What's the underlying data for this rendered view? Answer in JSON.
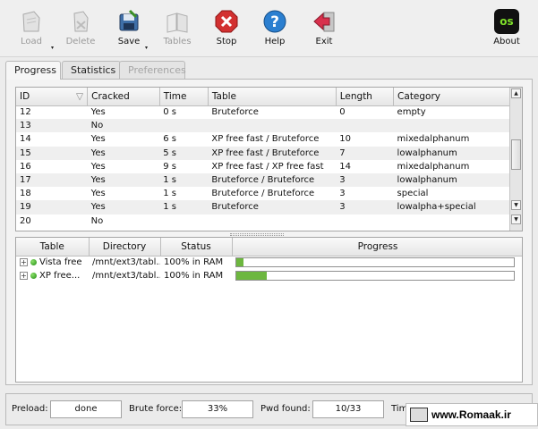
{
  "toolbar": {
    "load": "Load",
    "delete": "Delete",
    "save": "Save",
    "tables": "Tables",
    "stop": "Stop",
    "help": "Help",
    "exit": "Exit",
    "about": "About",
    "about_logo_text": "os"
  },
  "tabs": {
    "progress": "Progress",
    "statistics": "Statistics",
    "preferences": "Preferences"
  },
  "top_table": {
    "headers": [
      "ID",
      "Cracked",
      "Time",
      "Table",
      "Length",
      "Category"
    ],
    "rows": [
      [
        "12",
        "Yes",
        "0 s",
        "Bruteforce",
        "0",
        "empty"
      ],
      [
        "13",
        "No",
        "",
        "",
        "",
        ""
      ],
      [
        "14",
        "Yes",
        "6 s",
        "XP free fast / Bruteforce",
        "10",
        "mixedalphanum"
      ],
      [
        "15",
        "Yes",
        "5 s",
        "XP free fast / Bruteforce",
        "7",
        "lowalphanum"
      ],
      [
        "16",
        "Yes",
        "9 s",
        "XP free fast / XP free fast",
        "14",
        "mixedalphanum"
      ],
      [
        "17",
        "Yes",
        "1 s",
        "Bruteforce / Bruteforce",
        "3",
        "lowalphanum"
      ],
      [
        "18",
        "Yes",
        "1 s",
        "Bruteforce / Bruteforce",
        "3",
        "special"
      ],
      [
        "19",
        "Yes",
        "1 s",
        "Bruteforce",
        "3",
        "lowalpha+special"
      ],
      [
        "20",
        "No",
        "",
        "",
        "",
        ""
      ]
    ]
  },
  "bottom_table": {
    "headers": [
      "Table",
      "Directory",
      "Status",
      "Progress"
    ],
    "rows": [
      {
        "table": "Vista free",
        "directory": "/mnt/ext3/tabl...",
        "status": "100% in RAM",
        "progress": 0.025
      },
      {
        "table": "XP free...",
        "directory": "/mnt/ext3/tabl...",
        "status": "100% in RAM",
        "progress": 0.11
      }
    ]
  },
  "statusbar": {
    "preload_label": "Preload:",
    "preload_value": "done",
    "brute_label": "Brute force:",
    "brute_value": "33%",
    "pwd_label": "Pwd found:",
    "pwd_value": "10/33",
    "time_label": "Tim"
  },
  "watermark": {
    "text": "www.Romaak.ir"
  },
  "colors": {
    "progress_fill": "#6db73f",
    "stop_red": "#d23030",
    "help_blue": "#2b7fd0"
  }
}
